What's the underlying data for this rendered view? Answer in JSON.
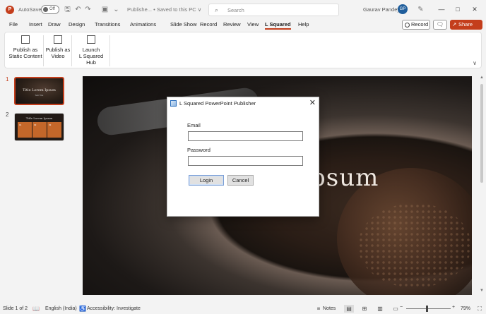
{
  "titlebar": {
    "app_icon_letter": "P",
    "autosave_label": "AutoSave",
    "autosave_state": "Off",
    "doc_title": "Publishe...  •  Saved to this PC ∨",
    "search_placeholder": "Search",
    "user_name": "Gaurav Pandey",
    "user_initials": "GP",
    "icons": [
      "save-icon",
      "undo-icon",
      "redo-icon",
      "present-icon",
      "customize-icon",
      "pen-icon"
    ]
  },
  "tabs": [
    "File",
    "Insert",
    "Draw",
    "Design",
    "Transitions",
    "Animations",
    "Slide Show",
    "Record",
    "Review",
    "View",
    "L Squared",
    "Help"
  ],
  "active_tab": "L Squared",
  "header_buttons": {
    "record": "Record",
    "share": "Share"
  },
  "ribbon": {
    "publish_static": [
      "Publish as",
      "Static Content"
    ],
    "publish_video": [
      "Publish as",
      "Video"
    ],
    "launch_hub": [
      "Launch",
      "L Squared Hub"
    ]
  },
  "slides": [
    {
      "number": "1",
      "title": "Title Lorem Ipsum",
      "subtitle": "Sub Title"
    },
    {
      "number": "2",
      "title": "Title Lorem Ipsum",
      "cols": [
        "01",
        "02",
        "03"
      ]
    }
  ],
  "main_slide": {
    "visible_title": "psum"
  },
  "dialog": {
    "title": "L Squared PowerPoint Publisher",
    "email_label": "Email",
    "email_value": "",
    "password_label": "Password",
    "password_value": "",
    "login_label": "Login",
    "cancel_label": "Cancel"
  },
  "statusbar": {
    "slide_info": "Slide 1 of 2",
    "language": "English (India)",
    "accessibility": "Accessibility: Investigate",
    "notes": "Notes",
    "zoom": "79%"
  },
  "colors": {
    "accent": "#c43e1c",
    "avatar": "#1f5e9c"
  }
}
